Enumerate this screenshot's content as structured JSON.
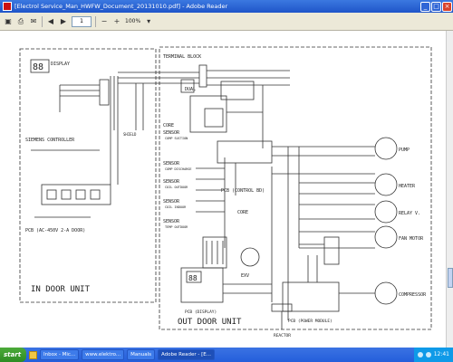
{
  "window": {
    "title": "[Electrol Service_Man_HWFW_Document_20131010.pdf] - Adobe Reader",
    "minimize": "_",
    "maximize": "□",
    "close": "×"
  },
  "toolbar": {
    "page_value": "1",
    "zoom": "100%",
    "icons": [
      "open-icon",
      "print-icon",
      "email-icon",
      "prev-page-icon",
      "next-page-icon",
      "zoom-icon"
    ]
  },
  "schematic": {
    "display_label": "DISPLAY",
    "display_digits": "88",
    "siemens_label": "SIEMENS CONTROLLER",
    "pcb_ac_label": "PCB (AC-450V 2-A DOOR)",
    "indoor_label": "IN DOOR UNIT",
    "terminal_block_label": "TERMINAL BLOCK",
    "dual_label": "DUAL",
    "core_label": "CORE",
    "sensors": [
      {
        "name": "SENSOR",
        "sub": "COMP SUCTION"
      },
      {
        "name": "SENSOR",
        "sub": "COMP DISCHARGE"
      },
      {
        "name": "SENSOR",
        "sub": "COIL OUTDOOR"
      },
      {
        "name": "SENSOR",
        "sub": "COIL INDOOR"
      },
      {
        "name": "SENSOR",
        "sub": "TEMP OUTDOOR"
      }
    ],
    "pcb_control_label": "PCB (CONTROL BD)",
    "shield_label": "SHIELD",
    "core_label2": "CORE",
    "pump_label": "PUMP",
    "heater_label": "HEATER",
    "relay_label": "RELAY V.",
    "fan_motor_label": "FAN MOTOR",
    "compressor_label": "COMPRESSOR",
    "exv_label": "EXV",
    "pcb_display_label": "PCB (DISPLAY)",
    "pcb_display_digits": "88",
    "power_module_label": "PCB (POWER MODULE)",
    "reactor_label": "REACTOR",
    "outdoor_label": "OUT DOOR UNIT"
  },
  "taskbar": {
    "start": "start",
    "tasks": [
      "Inbox - Mic...",
      "www.elektro...",
      "Manuals",
      "Adobe Reader - [E..."
    ],
    "clock": "12:41"
  }
}
